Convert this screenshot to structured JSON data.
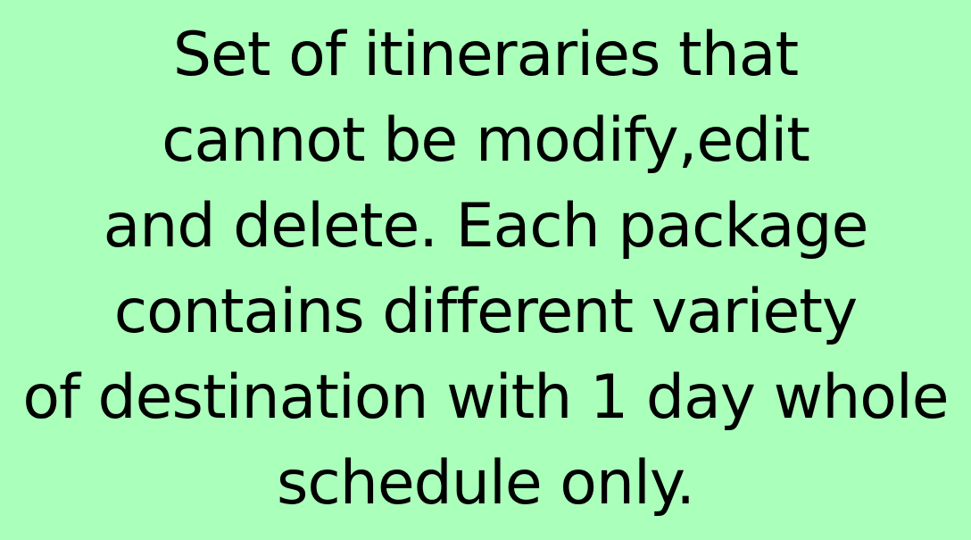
{
  "colors": {
    "background": "#aaffbb",
    "text": "#000000"
  },
  "text_block": {
    "lines": [
      "Set of itineraries that",
      "cannot be modify,edit",
      "and delete. Each package",
      "contains different variety",
      "of destination with 1 day whole",
      "schedule only."
    ]
  }
}
